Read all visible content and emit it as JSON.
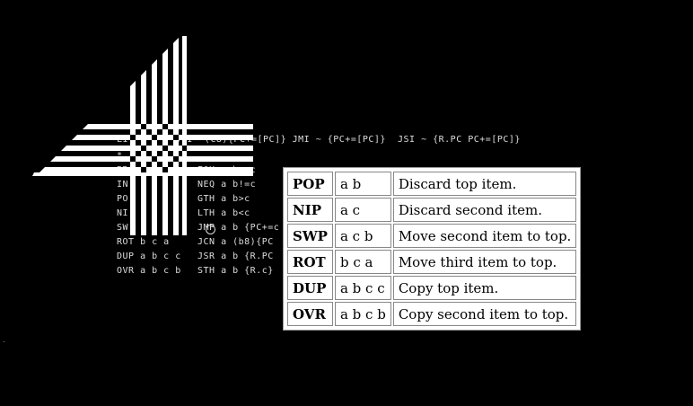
{
  "background_text": {
    "top_line": "LI        JCI  (C8){PC+=[PC]} JMI ~ {PC+=[PC]}  JSI ~ {R.PC PC+=[PC]}",
    "line_star": "*",
    "rows": [
      {
        "left": "BR",
        "right": "EQU a b==c"
      },
      {
        "left": "IN",
        "right": "NEQ a b!=c"
      },
      {
        "left": "PO",
        "right": "GTH a b>c"
      },
      {
        "left": "NI",
        "right": "LTH a b<c"
      },
      {
        "left": "SW",
        "right": "JMP a b {PC+=c"
      },
      {
        "left": "ROT b c a",
        "right": "JCN a (b8){PC"
      },
      {
        "left": "DUP a b c c",
        "right": "JSR a b {R.PC"
      },
      {
        "left": "OVR a b c b",
        "right": "STH a b {R.c}"
      }
    ]
  },
  "ops_table": [
    {
      "op": "POP",
      "stack": "a b",
      "desc": "Discard top item."
    },
    {
      "op": "NIP",
      "stack": "a c",
      "desc": "Discard second item."
    },
    {
      "op": "SWP",
      "stack": "a c b",
      "desc": "Move second item to top."
    },
    {
      "op": "ROT",
      "stack": "b c a",
      "desc": "Move third item to top."
    },
    {
      "op": "DUP",
      "stack": "a b c c",
      "desc": "Copy top item."
    },
    {
      "op": "OVR",
      "stack": "a b c b",
      "desc": "Copy second item to top."
    }
  ],
  "icons": {
    "logo": "woven-plus-logo-icon",
    "cursor": "crosshair-cursor-icon"
  }
}
